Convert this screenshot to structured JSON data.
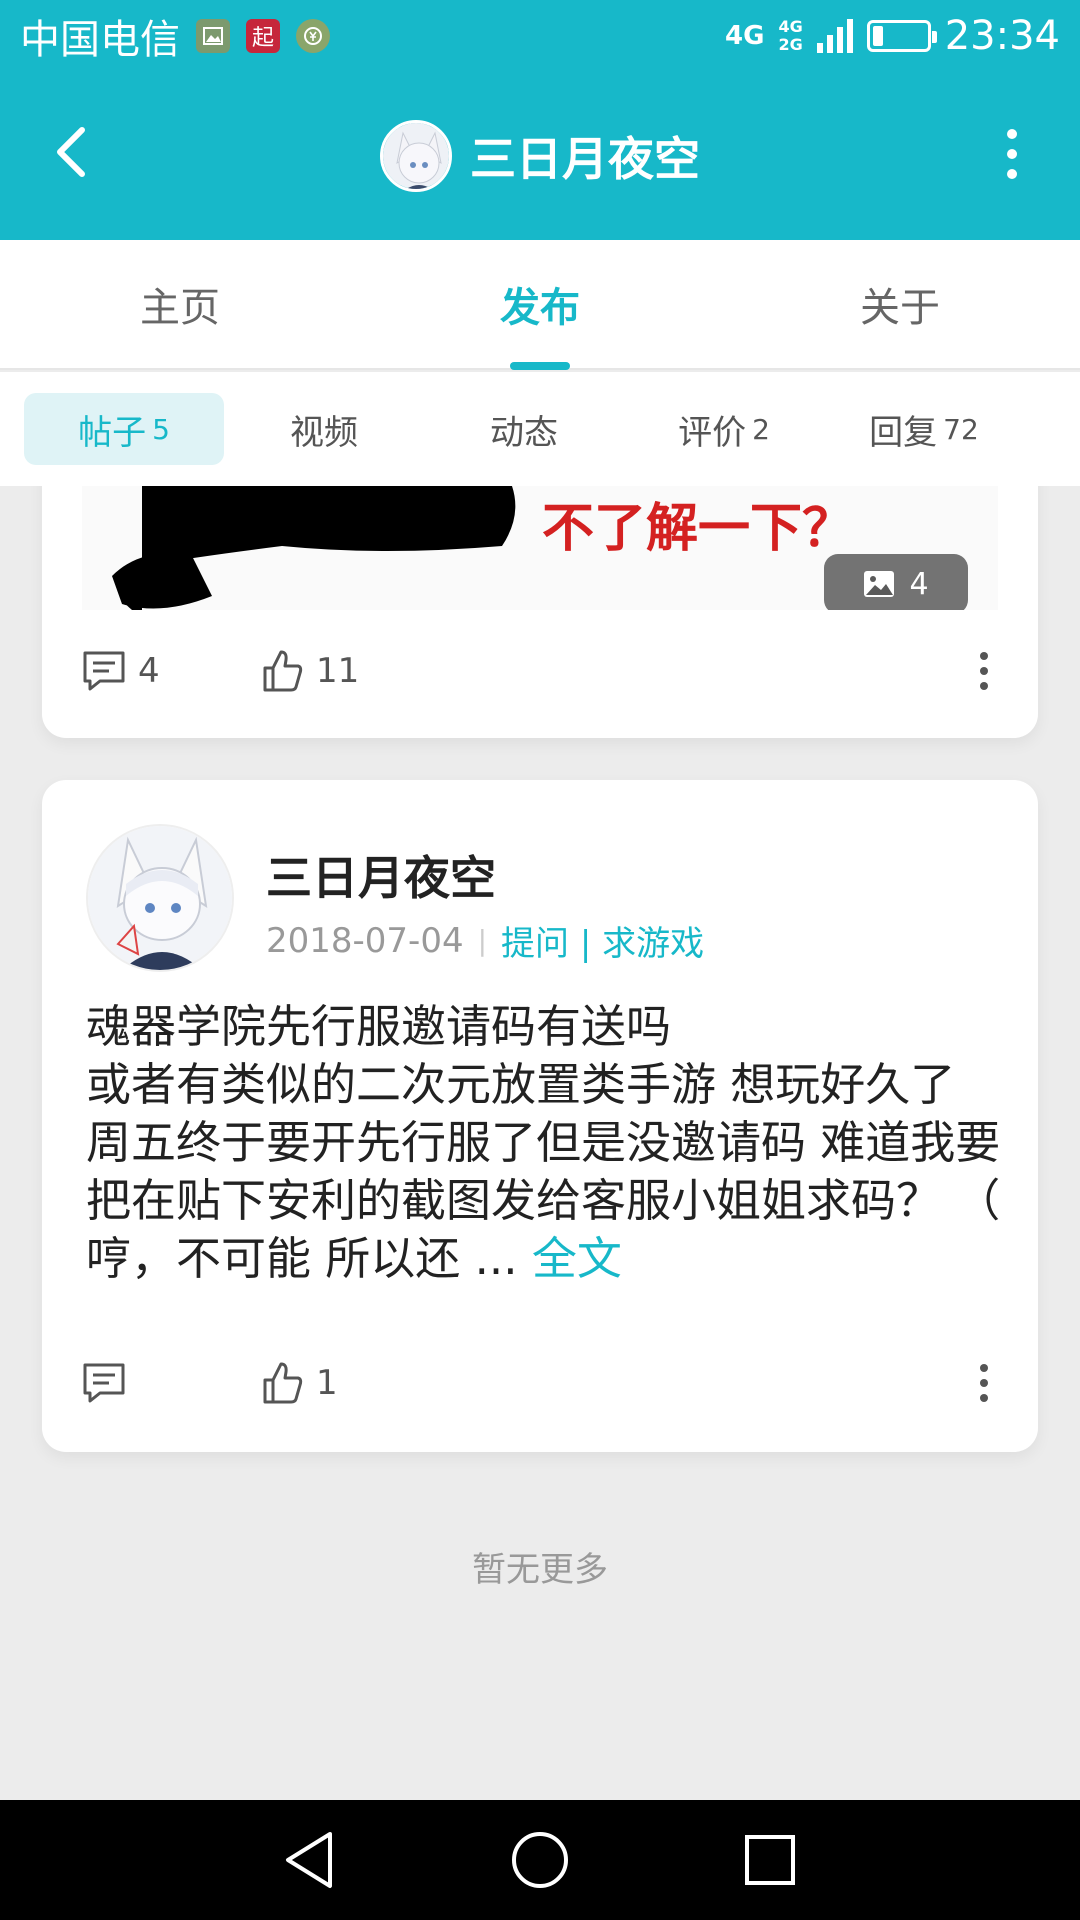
{
  "status_bar": {
    "carrier": "中国电信",
    "app_icon_qi": "起",
    "network_primary": "4G",
    "network_secondary_top": "4G",
    "network_secondary_bottom": "2G",
    "time": "23:34",
    "battery_level": 0.2
  },
  "header": {
    "title": "三日月夜空",
    "avatar_icon": "fox-girl-avatar"
  },
  "main_tabs": [
    {
      "label": "主页",
      "active": false
    },
    {
      "label": "发布",
      "active": true
    },
    {
      "label": "关于",
      "active": false
    }
  ],
  "sub_tabs": [
    {
      "label": "帖子",
      "count": "5",
      "active": true
    },
    {
      "label": "视频",
      "count": "",
      "active": false
    },
    {
      "label": "动态",
      "count": "",
      "active": false
    },
    {
      "label": "评价",
      "count": "2",
      "active": false
    },
    {
      "label": "回复",
      "count": "72",
      "active": false
    }
  ],
  "post1": {
    "image_caption": "不了解一下？",
    "image_count": "4",
    "comments": "4",
    "likes": "11"
  },
  "post2": {
    "author": "三日月夜空",
    "date": "2018-07-04",
    "category": "提问 | 求游戏",
    "body": "魂器学院先行服邀请码有送吗\n或者有类似的二次元放置类手游 想玩好久了 周五终于要开先行服了但是没邀请码 难道我要把在贴下安利的截图发给客服小姐姐求码？ （ 哼，不可能 所以还 ...",
    "read_more": "全文",
    "comments": "",
    "likes": "1"
  },
  "footer_text": "暂无更多",
  "colors": {
    "accent": "#17b8c9",
    "background": "#ececec"
  }
}
